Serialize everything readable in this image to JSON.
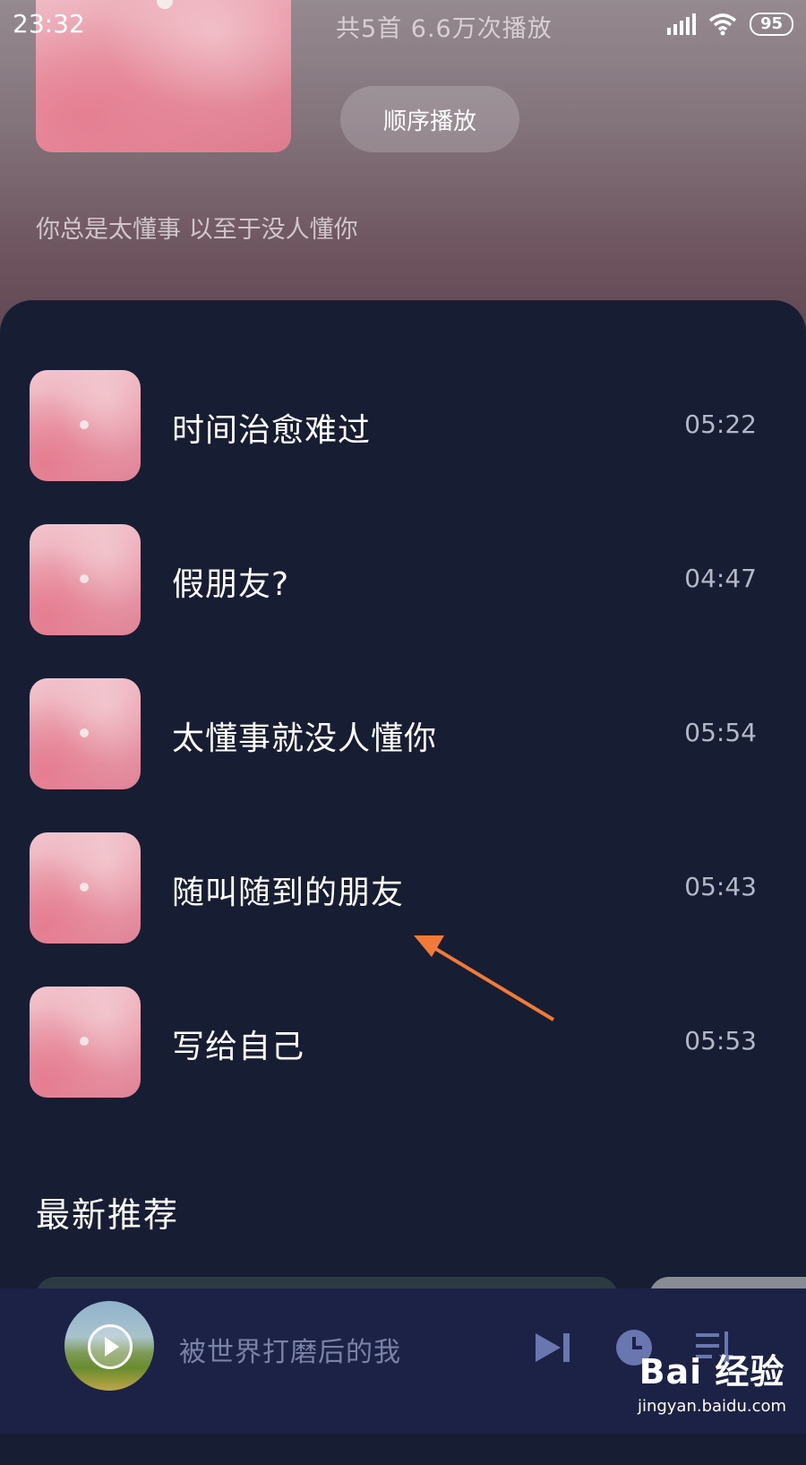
{
  "status_bar": {
    "time": "23:32",
    "battery": "95"
  },
  "header": {
    "stats": "共5首   6.6万次播放",
    "play_order_label": "顺序播放",
    "description": "你总是太懂事 以至于没人懂你"
  },
  "songs": [
    {
      "title": "时间治愈难过",
      "duration": "05:22"
    },
    {
      "title": "假朋友?",
      "duration": "04:47"
    },
    {
      "title": "太懂事就没人懂你",
      "duration": "05:54"
    },
    {
      "title": "随叫随到的朋友",
      "duration": "05:43"
    },
    {
      "title": "写给自己",
      "duration": "05:53"
    }
  ],
  "recommend": {
    "title": "最新推荐"
  },
  "player": {
    "now_playing": "被世界打磨后的我",
    "icons": [
      "next-track-icon",
      "timer-icon",
      "playlist-icon"
    ]
  },
  "watermark": {
    "brand": "Bai 经验",
    "url": "jingyan.baidu.com"
  },
  "colors": {
    "accent_arrow": "#f07a37",
    "panel_bg": "#171e33",
    "player_bg": "#1b2245"
  }
}
